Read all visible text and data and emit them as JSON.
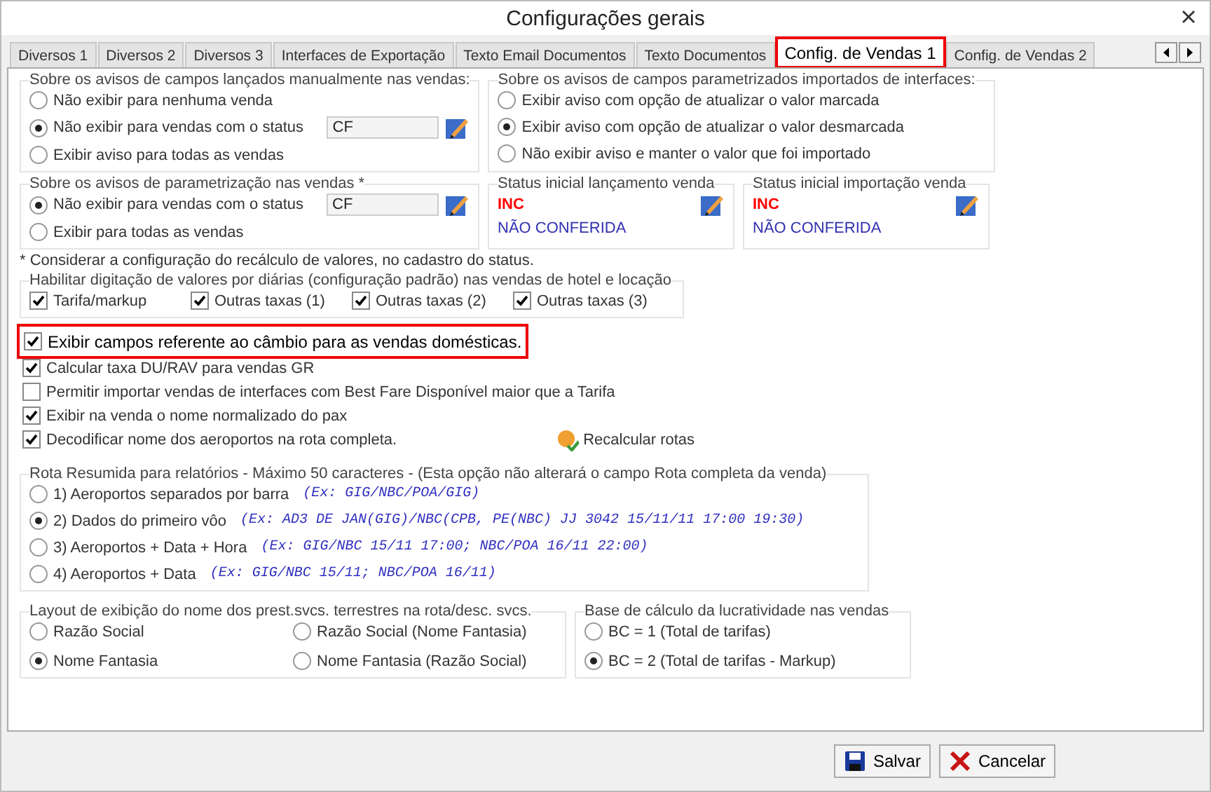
{
  "window": {
    "title": "Configurações gerais"
  },
  "tabs": [
    {
      "label": "Diversos 1",
      "selected": false,
      "highlighted": false
    },
    {
      "label": "Diversos 2",
      "selected": false,
      "highlighted": false
    },
    {
      "label": "Diversos 3",
      "selected": false,
      "highlighted": false
    },
    {
      "label": "Interfaces de Exportação",
      "selected": false,
      "highlighted": false
    },
    {
      "label": "Texto Email Documentos",
      "selected": false,
      "highlighted": false
    },
    {
      "label": "Texto Documentos",
      "selected": false,
      "highlighted": false
    },
    {
      "label": "Config. de Vendas 1",
      "selected": true,
      "highlighted": true
    },
    {
      "label": "Config. de Vendas 2",
      "selected": false,
      "highlighted": false
    }
  ],
  "row1": [
    {
      "kind": "radios",
      "title": "Sobre os avisos de campos lançados manualmente nas vendas:",
      "options": [
        {
          "label": "Não exibir para nenhuma venda",
          "selected": false
        },
        {
          "label": "Não exibir para vendas com o status",
          "selected": true,
          "field": "CF"
        },
        {
          "label": "Exibir aviso para todas as vendas",
          "selected": false
        }
      ]
    },
    {
      "kind": "radios",
      "title": "Sobre os avisos de campos parametrizados importados de interfaces:",
      "options": [
        {
          "label": "Exibir aviso com opção de atualizar o valor marcada",
          "selected": false
        },
        {
          "label": "Exibir aviso com opção de atualizar o valor desmarcada",
          "selected": true
        },
        {
          "label": "Não exibir aviso e manter o valor que foi importado",
          "selected": false
        }
      ]
    }
  ],
  "row2": [
    {
      "kind": "radios",
      "title": "Sobre os avisos de parametrização nas vendas *",
      "options": [
        {
          "label": "Não exibir para vendas com o status",
          "selected": true,
          "field": "CF"
        },
        {
          "label": "Exibir para todas as vendas",
          "selected": false
        }
      ]
    },
    {
      "kind": "status",
      "title": "Status inicial lançamento venda",
      "code": "INC",
      "description": "NÃO CONFERIDA"
    },
    {
      "kind": "status",
      "title": "Status inicial importação venda",
      "code": "INC",
      "description": "NÃO CONFERIDA"
    }
  ],
  "note": "* Considerar a configuração do recálculo de valores, no cadastro do status.",
  "daily_values": {
    "title": "Habilitar digitação de valores por diárias (configuração padrão) nas vendas de hotel e locação",
    "options": [
      {
        "label": "Tarifa/markup",
        "checked": true
      },
      {
        "label": "Outras taxas (1)",
        "checked": true
      },
      {
        "label": "Outras taxas (2)",
        "checked": true
      },
      {
        "label": "Outras taxas (3)",
        "checked": true
      }
    ]
  },
  "checkboxes": [
    {
      "label": "Exibir campos referente ao câmbio para as vendas domésticas.",
      "checked": true,
      "highlighted": true
    },
    {
      "label": "Calcular taxa DU/RAV para vendas GR",
      "checked": true,
      "highlighted": false
    },
    {
      "label": "Permitir importar vendas de interfaces com Best Fare Disponível maior que a Tarifa",
      "checked": false,
      "highlighted": false
    },
    {
      "label": "Exibir na venda o nome normalizado do pax",
      "checked": true,
      "highlighted": false
    },
    {
      "label": "Decodificar nome dos aeroportos na rota completa.",
      "checked": true,
      "highlighted": false
    }
  ],
  "recalc_button": {
    "label": "Recalcular rotas"
  },
  "route_summary": {
    "title": "Rota Resumida para relatórios - Máximo 50 caracteres - (Esta opção não alterará o campo Rota completa da venda)",
    "options": [
      {
        "label": "1) Aeroportos separados por barra",
        "example": "(Ex: GIG/NBC/POA/GIG)",
        "selected": false
      },
      {
        "label": "2) Dados do primeiro vôo",
        "example": "(Ex: AD3 DE JAN(GIG)/NBC(CPB, PE(NBC) JJ 3042 15/11/11 17:00 19:30)",
        "selected": true
      },
      {
        "label": "3) Aeroportos + Data + Hora",
        "example": "(Ex: GIG/NBC 15/11 17:00; NBC/POA 16/11 22:00)",
        "selected": false
      },
      {
        "label": "4) Aeroportos + Data",
        "example": "(Ex: GIG/NBC 15/11; NBC/POA 16/11)",
        "selected": false
      }
    ]
  },
  "provider_name_layout": {
    "title": "Layout de exibição do nome dos prest.svcs. terrestres na rota/desc. svcs.",
    "options": [
      {
        "label": "Razão Social",
        "selected": false
      },
      {
        "label": "Razão Social (Nome Fantasia)",
        "selected": false
      },
      {
        "label": "Nome Fantasia",
        "selected": true
      },
      {
        "label": "Nome Fantasia (Razão Social)",
        "selected": false
      }
    ]
  },
  "profit_base": {
    "title": "Base de cálculo da lucratividade nas vendas",
    "options": [
      {
        "label": "BC = 1 (Total de tarifas)",
        "selected": false
      },
      {
        "label": "BC = 2 (Total de tarifas - Markup)",
        "selected": true
      }
    ]
  },
  "buttons": [
    {
      "label": "Salvar",
      "kind": "save"
    },
    {
      "label": "Cancelar",
      "kind": "cancel"
    }
  ]
}
